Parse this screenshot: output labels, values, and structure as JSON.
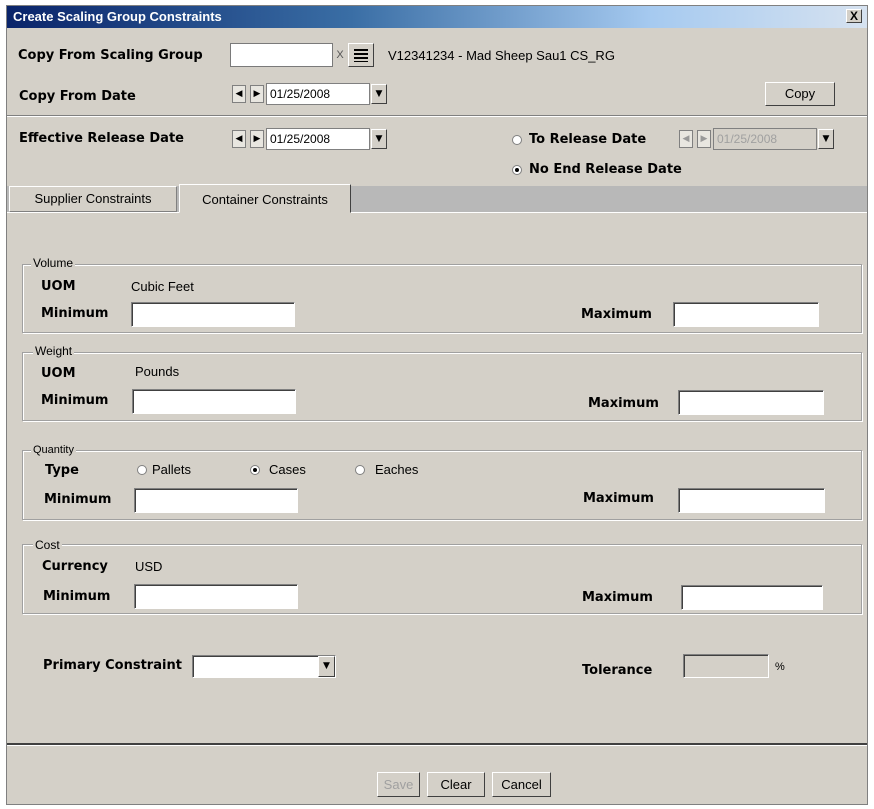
{
  "window": {
    "title": "Create Scaling Group Constraints",
    "close_label": "X"
  },
  "copy_from_group": {
    "label": "Copy From Scaling Group",
    "value": "",
    "clear_label": "X",
    "group_text": "V12341234  - Mad Sheep Sau1 CS_RG"
  },
  "copy_from_date": {
    "label": "Copy From Date",
    "value": "01/25/2008",
    "copy_button": "Copy"
  },
  "effective_release": {
    "label": "Effective Release Date",
    "value": "01/25/2008"
  },
  "end_release": {
    "to_release_label": "To Release Date",
    "to_release_value": "01/25/2008",
    "to_release_selected": false,
    "no_end_label": "No End Release Date",
    "no_end_selected": true
  },
  "tabs": [
    {
      "label": "Supplier Constraints",
      "active": false
    },
    {
      "label": "Container Constraints",
      "active": true
    }
  ],
  "volume": {
    "legend": "Volume",
    "uom_label": "UOM",
    "uom_value": "Cubic Feet",
    "min_label": "Minimum",
    "max_label": "Maximum",
    "min_value": "",
    "max_value": ""
  },
  "weight": {
    "legend": "Weight",
    "uom_label": "UOM",
    "uom_value": "Pounds",
    "min_label": "Minimum",
    "max_label": "Maximum",
    "min_value": "",
    "max_value": ""
  },
  "quantity": {
    "legend": "Quantity",
    "type_label": "Type",
    "options": [
      "Pallets",
      "Cases",
      "Eaches"
    ],
    "selected": "Cases",
    "min_label": "Minimum",
    "max_label": "Maximum",
    "min_value": "",
    "max_value": ""
  },
  "cost": {
    "legend": "Cost",
    "currency_label": "Currency",
    "currency_value": "USD",
    "min_label": "Minimum",
    "max_label": "Maximum",
    "min_value": "",
    "max_value": ""
  },
  "primary": {
    "label": "Primary Constraint",
    "value": ""
  },
  "tolerance": {
    "label": "Tolerance",
    "value": "",
    "unit": "%"
  },
  "footer": {
    "save": "Save",
    "clear": "Clear",
    "cancel": "Cancel"
  }
}
